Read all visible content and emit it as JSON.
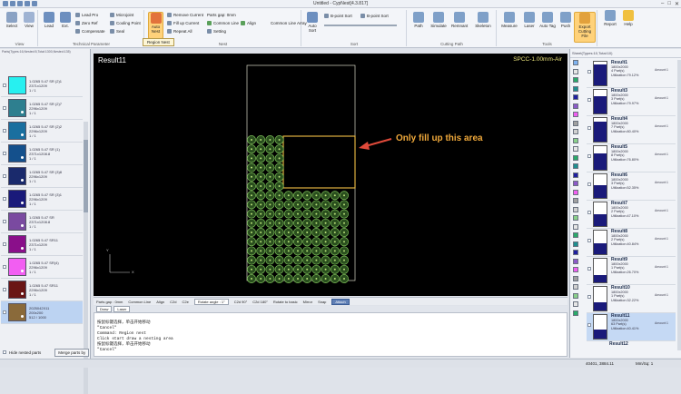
{
  "app": {
    "title": "Untitled - CypNest[4.3.817]"
  },
  "ribbon": {
    "groups": [
      {
        "label": "View"
      },
      {
        "label": "Technical Parameter"
      },
      {
        "label": "Nest"
      },
      {
        "label": "Sort"
      },
      {
        "label": "Cutting Path"
      },
      {
        "label": "Tools"
      }
    ],
    "buttons": {
      "select": "Select",
      "view": "View",
      "lead": "Lead",
      "ext": "Ext.",
      "auto_nest": "Auto Nest",
      "auto_sort": "Auto Sort",
      "path": "Path",
      "simulate": "Simulate",
      "remnant": "Remnant",
      "skeleton": "Skeleton",
      "measure": "Measure",
      "laser": "Laser",
      "auto_tag": "Auto Tag",
      "push": "Push",
      "export": "Export Cutting File",
      "report": "Report",
      "help": "Help"
    },
    "small": {
      "lead_prop": "Lead Pro",
      "zero_ref": "Zero Ref",
      "compensate": "Compensate",
      "microjoint": "Microjoint",
      "cooling_point": "Cooling Point",
      "seal": "Seal",
      "remove_current": "Remove Current",
      "fill_up_current": "Fill up Current",
      "repeat_all": "Repeat All",
      "parts_gap": "Parts gap: 0mm",
      "common_line": "Common Line",
      "align": "Align",
      "setting": "Setting",
      "common_line_array": "Common Line Array",
      "b_sort": "B-point Sort",
      "b_sort_2": "B-point Sort"
    },
    "tooltip": "Region Nest"
  },
  "left_panel": {
    "path": "Parts(Types:16,Nested:5,Total:1300,Nested:135)",
    "items": [
      {
        "line1": "1.0265 5.47 SR (2)1",
        "line2": "2371x1209",
        "line3": "1 / 1",
        "color": "#27f0f0"
      },
      {
        "line1": "1.0265 5.47 SR (2)7",
        "line2": "2296x1209",
        "line3": "1 / 1",
        "color": "#2e7f8f"
      },
      {
        "line1": "1.0265 5.47 SR (2)2",
        "line2": "2296x1209",
        "line3": "1 / 1",
        "color": "#1a6f9f"
      },
      {
        "line1": "1.0265 5.47 SR (1)",
        "line2": "2371x1208.8",
        "line3": "1 / 1",
        "color": "#14508c"
      },
      {
        "line1": "1.0265 5.47 SR (3)8",
        "line2": "2296x1209",
        "line3": "1 / 1",
        "color": "#1a2a6c"
      },
      {
        "line1": "1.0265 5.47 SR (3)1",
        "line2": "2296x1209",
        "line3": "1 / 1",
        "color": "#1a1a7a"
      },
      {
        "line1": "1.0265 5.47 SR",
        "line2": "2371x1208.8",
        "line3": "1 / 1",
        "color": "#7a4aa0"
      },
      {
        "line1": "1.0265 5.47 SR11",
        "line2": "2371x1209",
        "line3": "1 / 1",
        "color": "#8a0f8a"
      },
      {
        "line1": "1.0265 5.47 SR(4)",
        "line2": "2296x1209",
        "line3": "1 / 1",
        "color": "#f25ef2"
      },
      {
        "line1": "1.0265 5.47 SR11",
        "line2": "2296x1209",
        "line3": "1 / 1",
        "color": "#6a1515"
      },
      {
        "line1": "2025042X11",
        "line2": "200x200",
        "line3": "512 / 1000",
        "color": "#8a6a3a"
      }
    ],
    "footer": {
      "checkbox_label": "Hide nested parts",
      "button": "Merge parts by"
    }
  },
  "canvas": {
    "title": "Result11",
    "material": "SPCC-1.00mm-Air",
    "annotation": "Only fill up this area",
    "axis_x": "X",
    "axis_y": "Y"
  },
  "bottom_bar": {
    "parts_gap": "Parts gap : 0mm",
    "common_line": "Common Line",
    "align": "Align",
    "c2d": "C2d",
    "c2e": "C2e",
    "rotate": "Rotate angle : 1°",
    "c2d_90": "C2d 90°",
    "c2d_180": "C2d 180°",
    "rotate_basic": "Rotate to basic",
    "mirror": "Mirror",
    "snap": "Snap",
    "attach": "Attach"
  },
  "command": {
    "tabs": [
      "Draw",
      "Laser"
    ],
    "lines": [
      "按鼠标键选择，单击开始移动",
      "\"Cancel\"",
      "Command: Region nest",
      "Click start draw a nesting area",
      "按鼠标键选择，单击开始移动",
      "\"Cancel\""
    ]
  },
  "right_panel": {
    "header": "Sheet(Types:10,Total:10)",
    "colors": [
      "#7fb3f0",
      "#e6e6e6",
      "#2aaa6a",
      "#1f8f8f",
      "#1f1fa0",
      "#8c5ac8",
      "#f05ef0",
      "#a0a0a0",
      "#d0d0d0",
      "#8ad08a",
      "#e6e6e6",
      "#2aaa6a",
      "#1f8f8f",
      "#1f1fa0",
      "#8c5ac8",
      "#f05ef0",
      "#a0a0a0",
      "#d0d0d0",
      "#8ad08a",
      "#e6e6e6",
      "#2aaa6a",
      "#1f8f8f",
      "#1f1fa0",
      "#8c5ac8",
      "#f05ef0",
      "#a0a0a0",
      "#d0d0d0",
      "#8ad08a",
      "#e6e6e6",
      "#2aaa6a"
    ],
    "results": [
      {
        "name": "Result1",
        "size": "1800x2000",
        "parts": "4 Part(s)",
        "util": "Utilization:79.12%",
        "count": "Amount:1",
        "fill": 0.9
      },
      {
        "name": "Result3",
        "size": "1800x2000",
        "parts": "3 Part(s)",
        "util": "Utilization:79.97%",
        "count": "Amount:1",
        "fill": 0.75
      },
      {
        "name": "Result4",
        "size": "1800x2000",
        "parts": "7 Part(s)",
        "util": "Utilization:80.40%",
        "count": "Amount:1",
        "fill": 0.85
      },
      {
        "name": "Result5",
        "size": "1800x2000",
        "parts": "8 Part(s)",
        "util": "Utilization:76.80%",
        "count": "Amount:1",
        "fill": 0.7
      },
      {
        "name": "Result6",
        "size": "1800x2000",
        "parts": "3 Part(s)",
        "util": "Utilization:52.35%",
        "count": "Amount:1",
        "fill": 0.55
      },
      {
        "name": "Result7",
        "size": "1800x2000",
        "parts": "2 Part(s)",
        "util": "Utilization:47.10%",
        "count": "Amount:1",
        "fill": 0.5
      },
      {
        "name": "Result8",
        "size": "1800x2000",
        "parts": "2 Part(s)",
        "util": "Utilization:40.84%",
        "count": "Amount:1",
        "fill": 0.45
      },
      {
        "name": "Result9",
        "size": "1800x2000",
        "parts": "1 Part(s)",
        "util": "Utilization:26.70%",
        "count": "Amount:1",
        "fill": 0.3
      },
      {
        "name": "Result10",
        "size": "1800x2000",
        "parts": "1 Part(s)",
        "util": "Utilization:32.22%",
        "count": "Amount:1",
        "fill": 0.35
      },
      {
        "name": "Result11",
        "size": "1800x2000",
        "parts": "63 Part(s)",
        "util": "Utilization:40.41%",
        "count": "Amount:1",
        "fill": 0.4
      }
    ],
    "partial_next": "Result12"
  },
  "status": {
    "coords": "40401, 3884.11",
    "units": "Mm/Sq: 1"
  }
}
